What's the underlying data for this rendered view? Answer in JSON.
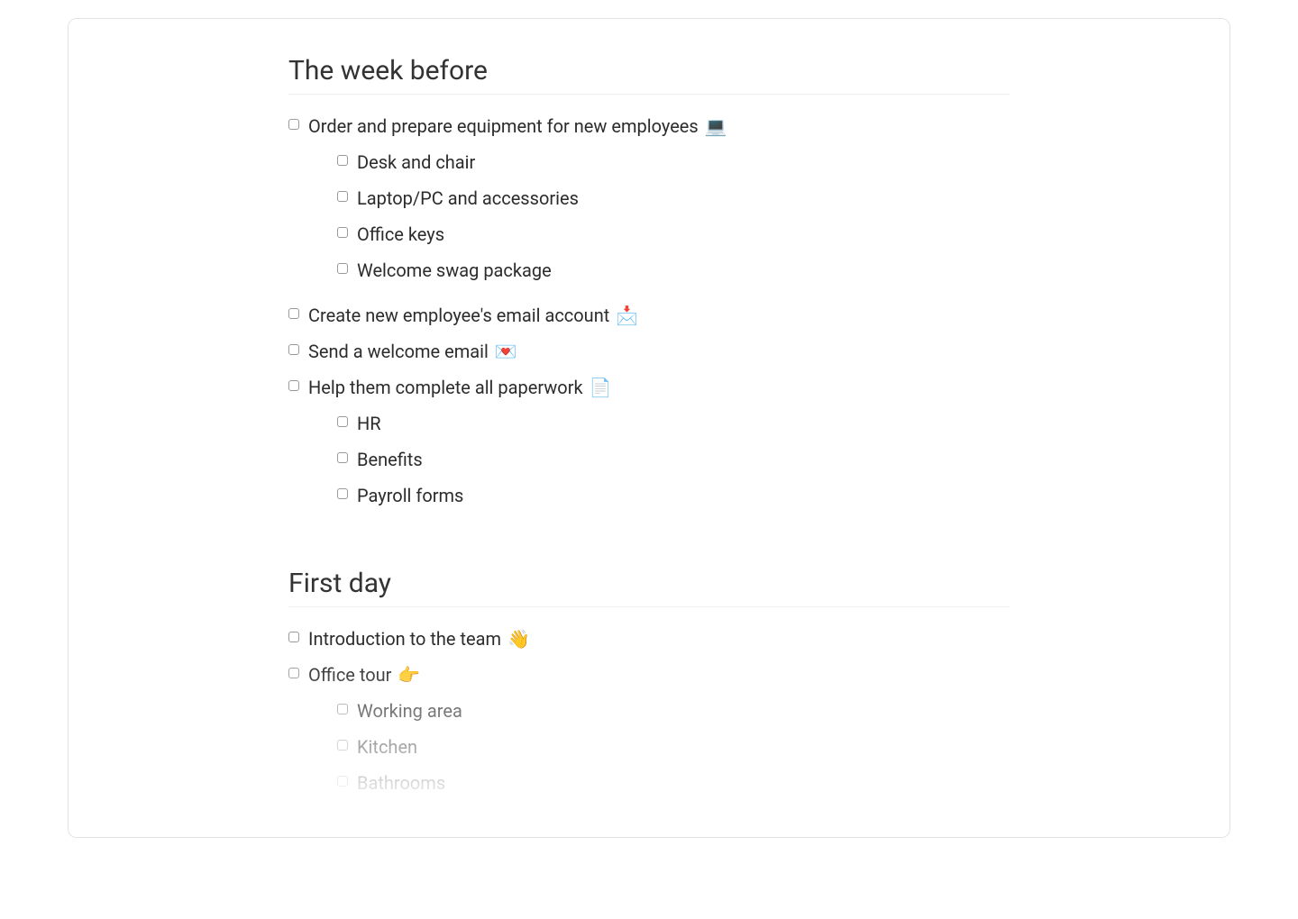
{
  "sections": [
    {
      "title": "The week before",
      "items": [
        {
          "label": "Order and prepare equipment for new employees",
          "emoji": "💻",
          "children": [
            {
              "label": "Desk and chair"
            },
            {
              "label": "Laptop/PC and accessories"
            },
            {
              "label": "Office keys"
            },
            {
              "label": "Welcome swag package"
            }
          ]
        },
        {
          "label": "Create new employee's email account",
          "emoji": "📩"
        },
        {
          "label": "Send a welcome email",
          "emoji": "💌"
        },
        {
          "label": "Help them complete all paperwork",
          "emoji": "📄",
          "children": [
            {
              "label": "HR"
            },
            {
              "label": "Benefits"
            },
            {
              "label": "Payroll forms"
            }
          ]
        }
      ]
    },
    {
      "title": "First day",
      "items": [
        {
          "label": "Introduction to the team",
          "emoji": "👋"
        },
        {
          "label": "Office tour",
          "emoji": "👉",
          "children": [
            {
              "label": "Working area"
            },
            {
              "label": "Kitchen"
            },
            {
              "label": "Bathrooms"
            }
          ]
        }
      ]
    }
  ]
}
